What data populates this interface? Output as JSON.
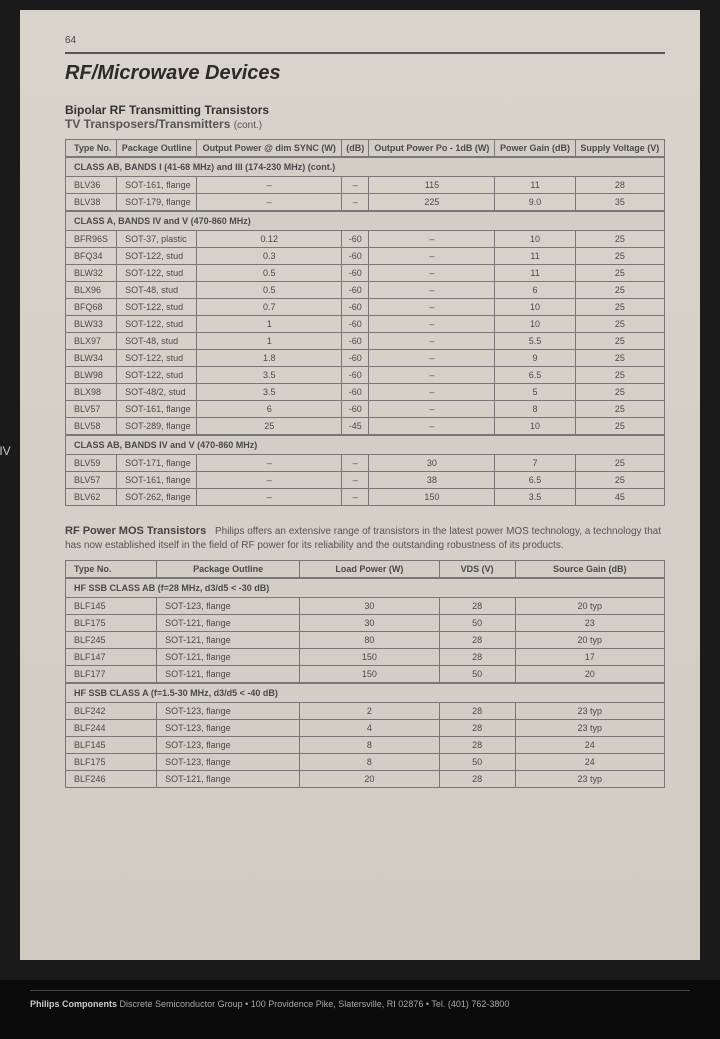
{
  "page_number": "64",
  "title": "RF/Microwave Devices",
  "side_tab": "IV",
  "section1_title": "Bipolar RF Transmitting Transistors",
  "section1_sub": "TV Transposers/Transmitters",
  "cont_label": "(cont.)",
  "table1": {
    "headers": [
      "Type No.",
      "Package Outline",
      "Output Power @ dim SYNC (W)",
      "(dB)",
      "Output Power Po - 1dB (W)",
      "Power Gain (dB)",
      "Supply Voltage (V)"
    ],
    "groups": [
      {
        "label": "CLASS AB, BANDS I (41-68 MHz) and III (174-230 MHz) (cont.)",
        "rows": [
          [
            "BLV36",
            "SOT-161, flange",
            "–",
            "–",
            "115",
            "11",
            "28"
          ],
          [
            "BLV38",
            "SOT-179, flange",
            "–",
            "–",
            "225",
            "9.0",
            "35"
          ]
        ]
      },
      {
        "label": "CLASS A, BANDS IV and V (470-860 MHz)",
        "rows": [
          [
            "BFR96S",
            "SOT-37, plastic",
            "0.12",
            "-60",
            "–",
            "10",
            "25"
          ],
          [
            "BFQ34",
            "SOT-122, stud",
            "0.3",
            "-60",
            "–",
            "11",
            "25"
          ],
          [
            "BLW32",
            "SOT-122, stud",
            "0.5",
            "-60",
            "–",
            "11",
            "25"
          ],
          [
            "BLX96",
            "SOT-48, stud",
            "0.5",
            "-60",
            "–",
            "6",
            "25"
          ],
          [
            "BFQ68",
            "SOT-122, stud",
            "0.7",
            "-60",
            "–",
            "10",
            "25"
          ],
          [
            "BLW33",
            "SOT-122, stud",
            "1",
            "-60",
            "–",
            "10",
            "25"
          ],
          [
            "BLX97",
            "SOT-48, stud",
            "1",
            "-60",
            "–",
            "5.5",
            "25"
          ],
          [
            "BLW34",
            "SOT-122, stud",
            "1.8",
            "-60",
            "–",
            "9",
            "25"
          ],
          [
            "BLW98",
            "SOT-122, stud",
            "3.5",
            "-60",
            "–",
            "6.5",
            "25"
          ],
          [
            "BLX98",
            "SOT-48/2, stud",
            "3.5",
            "-60",
            "–",
            "5",
            "25"
          ],
          [
            "BLV57",
            "SOT-161, flange",
            "6",
            "-60",
            "–",
            "8",
            "25"
          ],
          [
            "BLV58",
            "SOT-289, flange",
            "25",
            "-45",
            "–",
            "10",
            "25"
          ]
        ]
      },
      {
        "label": "CLASS AB, BANDS IV and V (470-860 MHz)",
        "rows": [
          [
            "BLV59",
            "SOT-171, flange",
            "–",
            "–",
            "30",
            "7",
            "25"
          ],
          [
            "BLV57",
            "SOT-161, flange",
            "–",
            "–",
            "38",
            "6.5",
            "25"
          ],
          [
            "BLV62",
            "SOT-262, flange",
            "–",
            "–",
            "150",
            "3.5",
            "45"
          ]
        ]
      }
    ]
  },
  "section2_lead": "RF Power MOS Transistors",
  "section2_intro": "Philips offers an extensive range of transistors in the latest power MOS technology, a technology that has now established itself in the field of RF power for its reliability and the outstanding robustness of its products.",
  "table2": {
    "headers": [
      "Type No.",
      "Package Outline",
      "Load Power (W)",
      "VDS (V)",
      "Source Gain (dB)"
    ],
    "groups": [
      {
        "label": "HF SSB CLASS AB (f=28 MHz, d3/d5 < -30 dB)",
        "rows": [
          [
            "BLF145",
            "SOT-123, flange",
            "30",
            "28",
            "20 typ"
          ],
          [
            "BLF175",
            "SOT-121, flange",
            "30",
            "50",
            "23"
          ],
          [
            "BLF245",
            "SOT-121, flange",
            "80",
            "28",
            "20 typ"
          ],
          [
            "BLF147",
            "SOT-121, flange",
            "150",
            "28",
            "17"
          ],
          [
            "BLF177",
            "SOT-121, flange",
            "150",
            "50",
            "20"
          ]
        ]
      },
      {
        "label": "HF SSB CLASS A (f=1.5-30 MHz, d3/d5 < -40 dB)",
        "rows": [
          [
            "BLF242",
            "SOT-123, flange",
            "2",
            "28",
            "23 typ"
          ],
          [
            "BLF244",
            "SOT-123, flange",
            "4",
            "28",
            "23 typ"
          ],
          [
            "BLF145",
            "SOT-123, flange",
            "8",
            "28",
            "24"
          ],
          [
            "BLF175",
            "SOT-123, flange",
            "8",
            "50",
            "24"
          ],
          [
            "BLF246",
            "SOT-121, flange",
            "20",
            "28",
            "23 typ"
          ]
        ]
      }
    ]
  },
  "footer_company": "Philips Components",
  "footer_text": "Discrete Semiconductor Group • 100 Providence Pike, Slatersville, RI 02876 • Tel. (401) 762-3800"
}
